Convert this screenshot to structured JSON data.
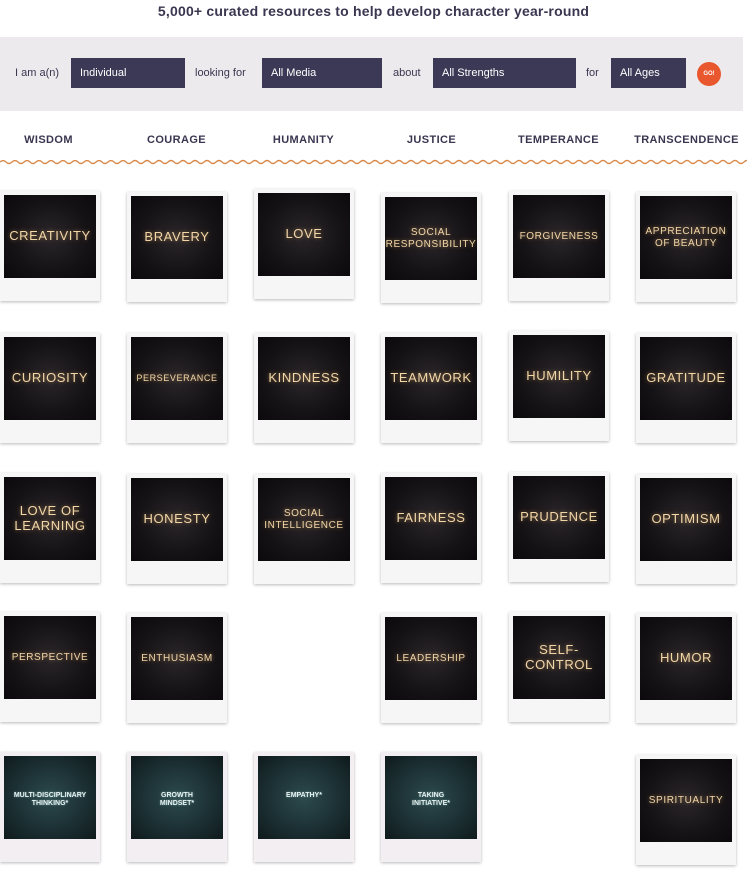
{
  "header": {
    "headline": "5,000+ curated resources to help develop character year-round"
  },
  "filters": {
    "i_am_label": "I am a(n)",
    "who_value": "Individual",
    "looking_for_label": "looking for",
    "media_value": "All Media",
    "about_label": "about",
    "strength_value": "All Strengths",
    "for_label": "for",
    "age_value": "All Ages",
    "go_label": "GO!",
    "go_color": "#e8572e",
    "select_color": "#3b3955"
  },
  "columns": [
    "WISDOM",
    "COURAGE",
    "HUMANITY",
    "JUSTICE",
    "TEMPERANCE",
    "TRANSCENDENCE"
  ],
  "cards": {
    "wisdom": [
      "CREATIVITY",
      "CURIOSITY",
      "LOVE OF\nLEARNING",
      "PERSPECTIVE",
      "MULTI-DISCIPLINARY\nTHINKING*"
    ],
    "courage": [
      "BRAVERY",
      "PERSEVERANCE",
      "HONESTY",
      "ENTHUSIASM",
      "GROWTH\nMINDSET*"
    ],
    "humanity": [
      "LOVE",
      "KINDNESS",
      "SOCIAL\nINTELLIGENCE",
      "EMPATHY*"
    ],
    "justice": [
      "SOCIAL\nRESPONSIBILITY",
      "TEAMWORK",
      "FAIRNESS",
      "LEADERSHIP",
      "TAKING\nINITIATIVE*"
    ],
    "temperance": [
      "FORGIVENESS",
      "HUMILITY",
      "PRUDENCE",
      "SELF-\nCONTROL"
    ],
    "transcendence": [
      "APPRECIATION\nOF BEAUTY",
      "GRATITUDE",
      "OPTIMISM",
      "HUMOR",
      "SPIRITUALITY"
    ]
  }
}
